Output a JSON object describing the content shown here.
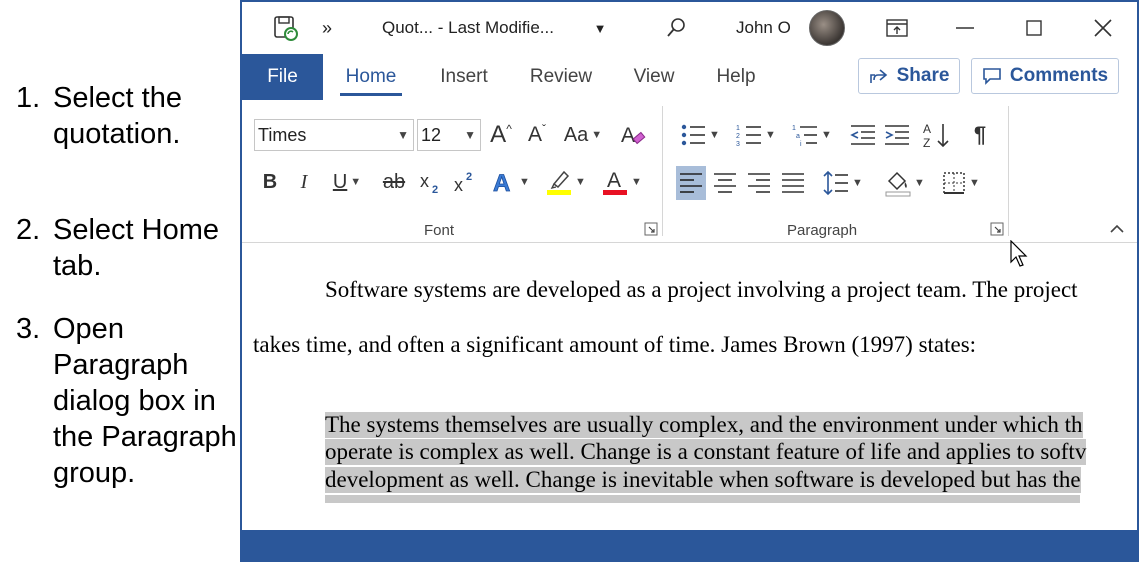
{
  "steps": [
    {
      "num": "1.",
      "text": "Select the quotation."
    },
    {
      "num": "2.",
      "text": "Select Home tab."
    },
    {
      "num": "3.",
      "text": "Open Paragraph dialog box in the Paragraph group."
    }
  ],
  "titlebar": {
    "doc_title": "Quot...  -  Last Modifie...",
    "overflow": "»",
    "user": "John O"
  },
  "tabs": {
    "file": "File",
    "home": "Home",
    "insert": "Insert",
    "review": "Review",
    "view": "View",
    "help": "Help",
    "share": "Share",
    "comments": "Comments"
  },
  "font": {
    "family": "Times",
    "size": "12",
    "group_label": "Font",
    "bold": "B",
    "italic": "I",
    "underline": "U",
    "strike": "ab",
    "grow": "A",
    "shrink": "A",
    "case": "Aa"
  },
  "paragraph": {
    "group_label": "Paragraph",
    "pilcrow": "¶"
  },
  "colors": {
    "accent": "#2b579a",
    "highlight": "#ffff00",
    "font_color": "#e81123",
    "selection": "#c8c8c8"
  },
  "document": {
    "line1": "Software systems are developed as a project involving a project team. The project",
    "line2": "takes time, and often a significant amount of time. James Brown (1997) states:",
    "quote1": "The systems themselves are usually complex, and the environment under which th",
    "quote2": "operate is complex as well. Change is a constant feature of life and applies to softv",
    "quote3": "development as well. Change is inevitable when software is developed but has the"
  }
}
